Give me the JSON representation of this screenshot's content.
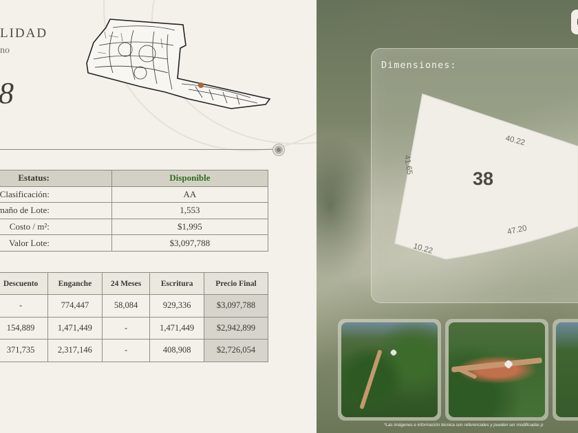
{
  "header": {
    "title": "LIDAD",
    "subtitle": "no",
    "lot_number": "8"
  },
  "info_table": {
    "rows": [
      {
        "label": "Estatus:",
        "value": "Disponible"
      },
      {
        "label": "Clasificación:",
        "value": "AA"
      },
      {
        "label": "amaño de Lote:",
        "value": "1,553"
      },
      {
        "label": "Costo / m²:",
        "value": "$1,995"
      },
      {
        "label": "Valor Lote:",
        "value": "$3,097,788"
      }
    ],
    "status_color": "#2f6d1f"
  },
  "payment_table": {
    "headers": [
      "Descuento",
      "Enganche",
      "24 Meses",
      "Escritura",
      "Precio Final"
    ],
    "rows": [
      [
        "-",
        "774,447",
        "58,084",
        "929,336",
        "$3,097,788"
      ],
      [
        "154,889",
        "1,471,449",
        "-",
        "1,471,449",
        "$2,942,899"
      ],
      [
        "371,735",
        "2,317,146",
        "-",
        "408,908",
        "$2,726,054"
      ]
    ]
  },
  "dimensions": {
    "title": "Dimensiones:",
    "lot_label": "38",
    "sides": [
      "40.22",
      "41.65",
      "47.20",
      "10.22"
    ]
  },
  "top_right_button": "P",
  "thumbnails": [
    {
      "name": "aerial-photo-1",
      "icon": "photo-icon"
    },
    {
      "name": "aerial-photo-2",
      "icon": "photo-icon"
    },
    {
      "name": "aerial-photo-3",
      "icon": "photo-icon"
    }
  ],
  "disclaimer": "*Las imágenes e información técnica son referenciales y pueden ser modificadas p",
  "colors": {
    "accent_status": "#2f6d1f",
    "panel_bg": "#f3f1ea",
    "table_header": "#d3d1c5"
  }
}
